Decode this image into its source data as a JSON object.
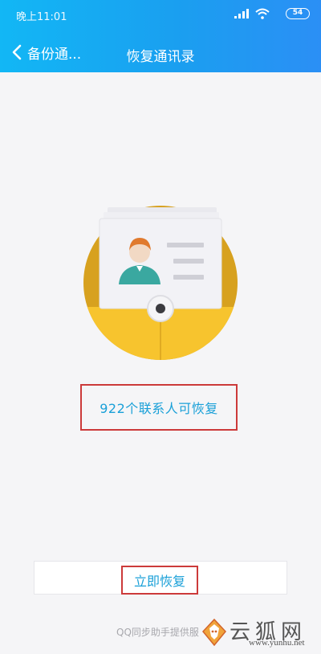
{
  "status_bar": {
    "time": "晚上11:01",
    "battery": "54"
  },
  "nav": {
    "back_label": "备份通...",
    "title": "恢复通讯录"
  },
  "main": {
    "contact_count_text": "922个联系人可恢复",
    "restore_button_label": "立即恢复"
  },
  "footer": {
    "provider_text": "QQ同步助手提供服"
  },
  "watermark": {
    "brand": "云狐网",
    "url": "www.yunhu.net"
  },
  "colors": {
    "header_start": "#12b7f5",
    "header_end": "#2b8ff5",
    "accent_text": "#1aa0d8",
    "highlight_border": "#cc3a3a",
    "envelope_yellow": "#f7c42e",
    "envelope_dark": "#d7a11f"
  },
  "icons": {
    "back": "chevron-left-icon",
    "signal": "signal-icon",
    "wifi": "wifi-icon",
    "battery": "battery-icon",
    "illustration": "contacts-envelope-icon",
    "watermark_logo": "fox-logo-icon"
  }
}
